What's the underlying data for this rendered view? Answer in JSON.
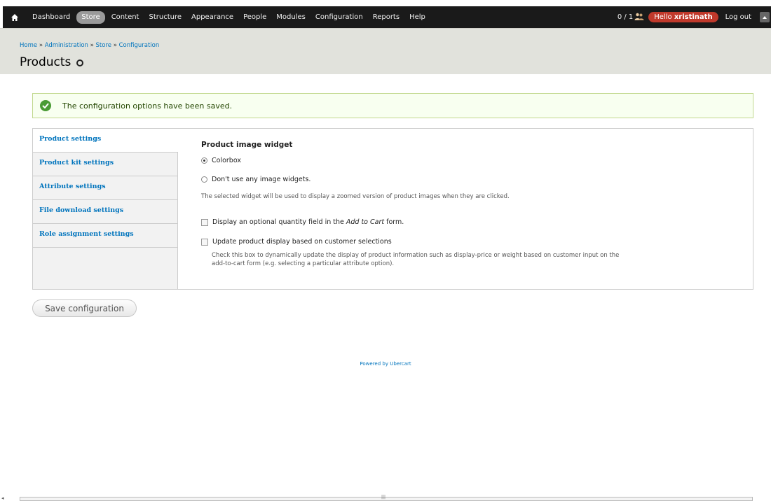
{
  "toolbar": {
    "menu": [
      "Dashboard",
      "Store",
      "Content",
      "Structure",
      "Appearance",
      "People",
      "Modules",
      "Configuration",
      "Reports",
      "Help"
    ],
    "active_item": "Store",
    "counter": "0 / 1",
    "hello_prefix": "Hello",
    "username": "xristinath",
    "logout": "Log out"
  },
  "breadcrumb": {
    "items": [
      "Home",
      "Administration",
      "Store",
      "Configuration"
    ],
    "separator": "»"
  },
  "page": {
    "title": "Products"
  },
  "message": {
    "text": "The configuration options have been saved."
  },
  "tabs": [
    "Product settings",
    "Product kit settings",
    "Attribute settings",
    "File download settings",
    "Role assignment settings"
  ],
  "settings": {
    "image_widget_title": "Product image widget",
    "option_colorbox": "Colorbox",
    "option_none": "Don't use any image widgets.",
    "widget_description": "The selected widget will be used to display a zoomed version of product images when they are clicked.",
    "qty_prefix": "Display an optional quantity field in the",
    "qty_em": "Add to Cart",
    "qty_suffix": "form.",
    "update_label": "Update product display based on customer selections",
    "update_desc_line1": "Check this box to dynamically update the display of product information such as display-price or weight based on customer input on the",
    "update_desc_line2": "add-to-cart form (e.g. selecting a particular attribute option)."
  },
  "actions": {
    "save": "Save configuration"
  },
  "footer": {
    "text": "Powered by Ubercart"
  },
  "colors": {
    "link": "#0074bd",
    "toolbar": "#1a1a1a",
    "user_badge": "#c0392b",
    "status_ok": "#4a9b35"
  }
}
